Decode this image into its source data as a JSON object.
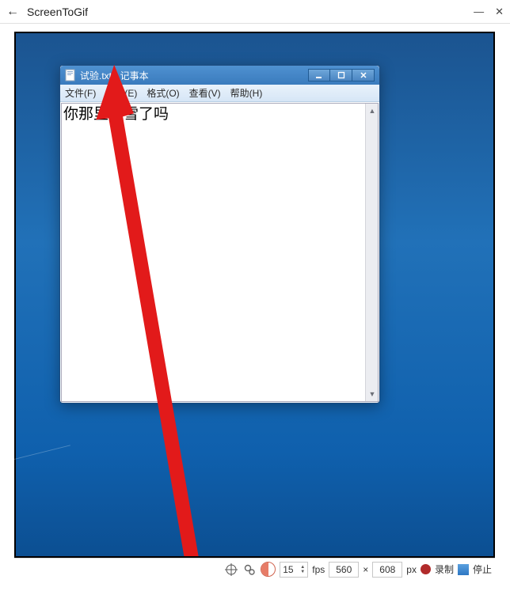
{
  "app": {
    "title": "ScreenToGif"
  },
  "notepad": {
    "title": "试验.txt - 记事本",
    "menu": {
      "file": "文件(F)",
      "edit": "编辑(E)",
      "format": "格式(O)",
      "view": "查看(V)",
      "help": "帮助(H)"
    },
    "content": "你那里下雪了吗"
  },
  "toolbar": {
    "fps_value": "15",
    "fps_label": "fps",
    "width": "560",
    "height": "608",
    "px_label": "px",
    "dim_sep": "×",
    "record": "录制",
    "stop": "停止"
  }
}
